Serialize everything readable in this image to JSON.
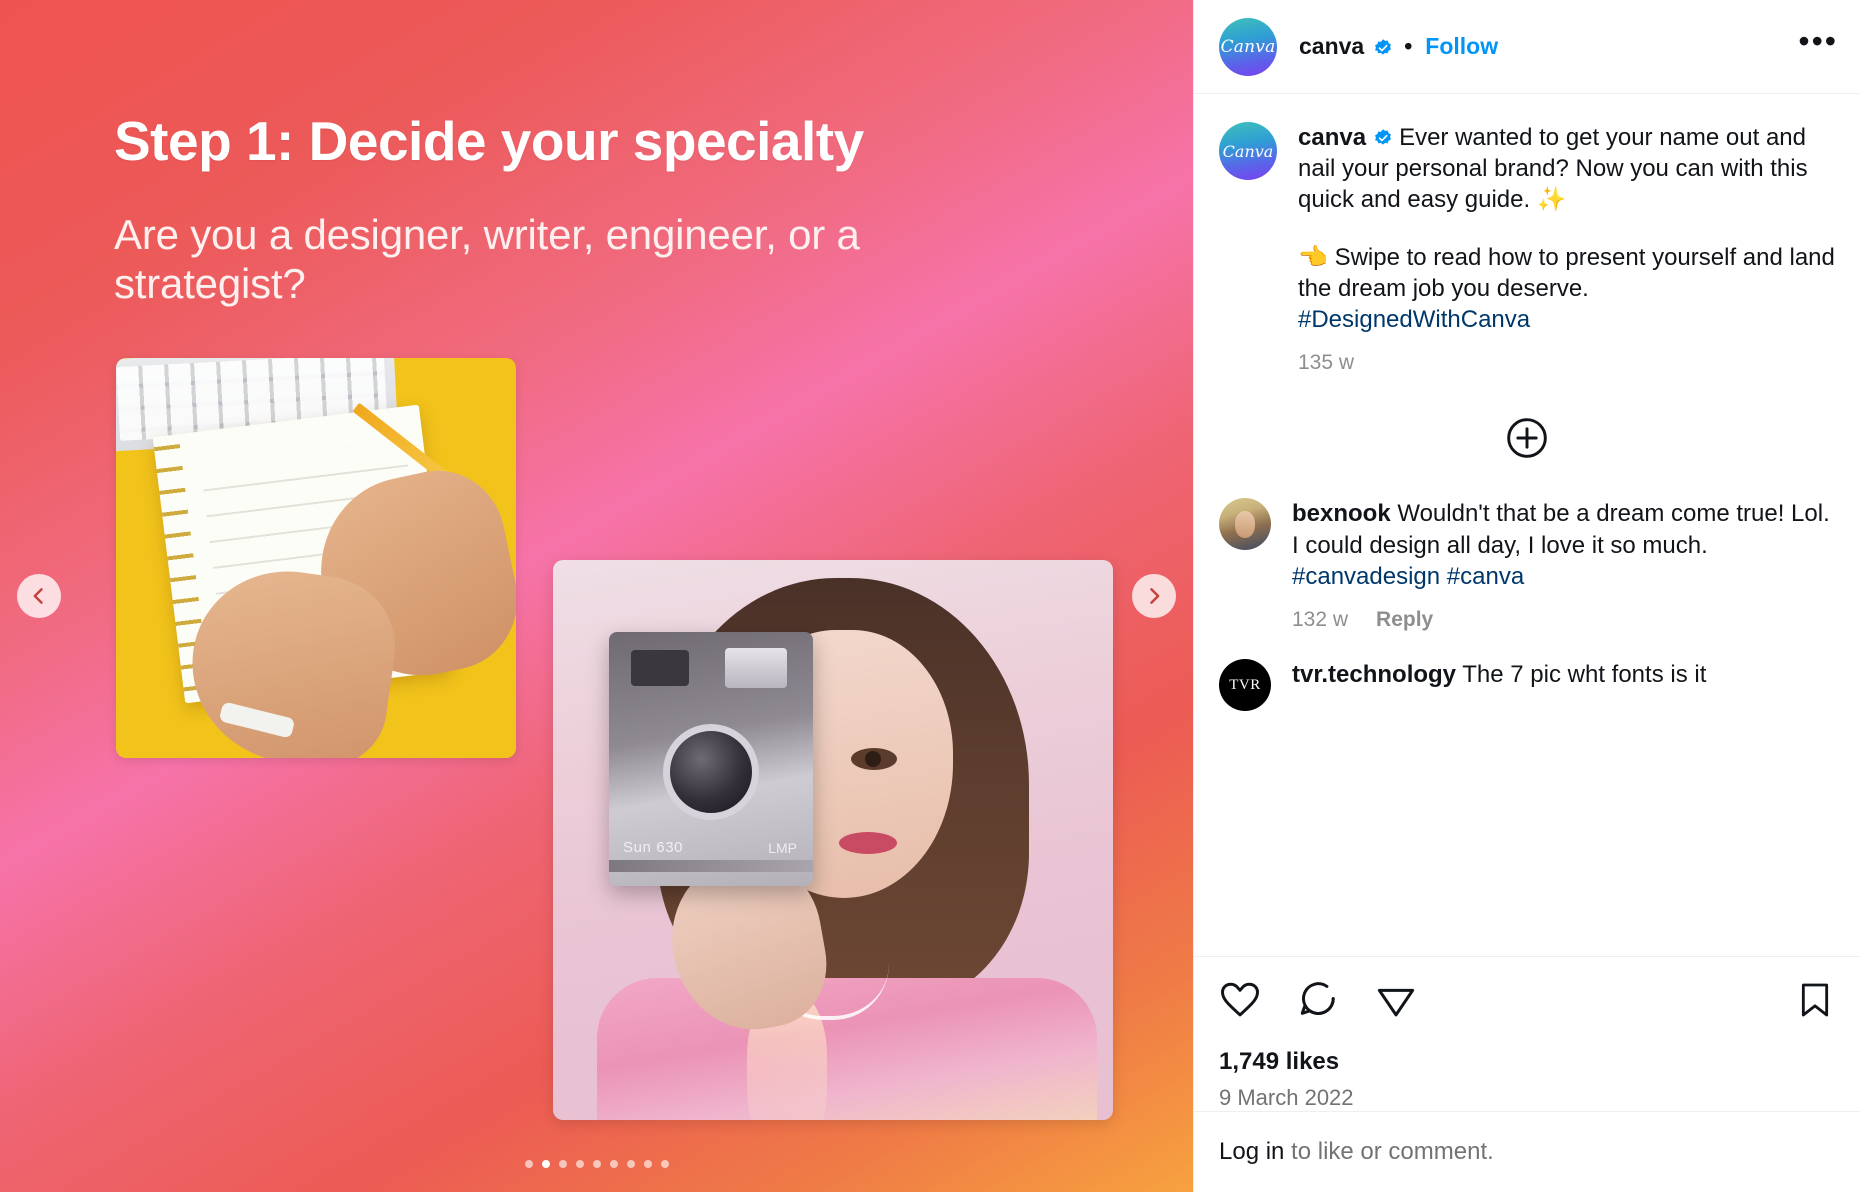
{
  "post_media": {
    "slide": {
      "headline": "Step 1: Decide your specialty",
      "subtext": "Are you a designer, writer, engineer, or a strategist?",
      "camera_label": "Sun 630",
      "camera_label2": "LMP"
    },
    "nav": {
      "prev_label": "Previous",
      "next_label": "Next"
    },
    "carousel": {
      "total_dots": 9,
      "active_index": 1
    }
  },
  "header": {
    "avatar_text": "Canva",
    "username": "canva",
    "verified_icon": "verified-badge-icon",
    "separator": "•",
    "follow_label": "Follow",
    "more_label": "•••"
  },
  "caption": {
    "avatar_text": "Canva",
    "username": "canva",
    "verified_icon": "verified-badge-icon",
    "paragraph1": "Ever wanted to get your name out and nail your personal brand? Now you can with this quick and easy guide. ✨",
    "paragraph2_emoji": "👈",
    "paragraph2": "Swipe to read how to present yourself and land the dream job you deserve.",
    "hashtag": "#DesignedWithCanva",
    "timestamp": "135 w"
  },
  "add_comment": {
    "icon": "plus-circle-icon",
    "label": "Add a comment"
  },
  "comments": [
    {
      "username": "bexnook",
      "text": "Wouldn't that be a dream come true! Lol. I could design all day, I love it so much. ",
      "hashtags": "#canvadesign #canva",
      "timestamp": "132 w",
      "reply_label": "Reply",
      "avatar_text": ""
    },
    {
      "username": "tvr.technology",
      "text": "The 7 pic wht fonts is it",
      "avatar_text": "TVR"
    }
  ],
  "actions": {
    "like_icon": "heart-icon",
    "comment_icon": "comment-bubble-icon",
    "share_icon": "share-paper-plane-icon",
    "save_icon": "bookmark-icon",
    "likes": "1,749 likes",
    "date": "9 March 2022"
  },
  "footer": {
    "login_label": "Log in",
    "rest_text": " to like or comment."
  },
  "colors": {
    "accent_blue": "#0095f6",
    "link_navy": "#00376b",
    "text_primary": "#111418",
    "text_muted": "#8e8e8e",
    "post_bg_red": "#ee5a52"
  }
}
